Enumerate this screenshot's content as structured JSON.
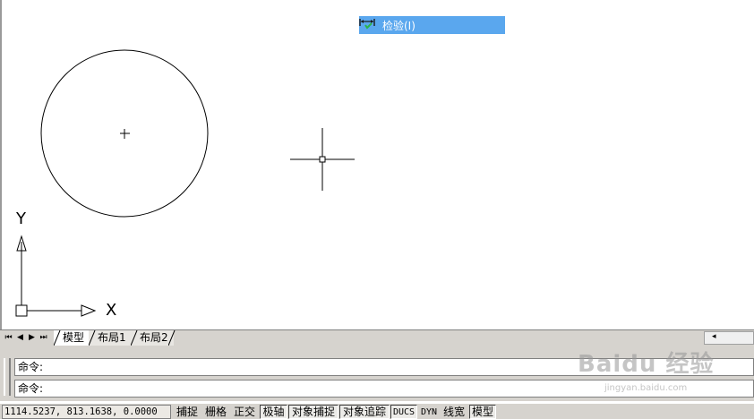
{
  "menu": {
    "item_label": "检验(I)"
  },
  "ucs": {
    "y_label": "Y",
    "x_label": "X"
  },
  "tabs": {
    "nav_first": "⏮",
    "nav_prev": "◀",
    "nav_next": "▶",
    "nav_last": "⏭",
    "items": [
      {
        "label": "模型",
        "active": true
      },
      {
        "label": "布局1",
        "active": false
      },
      {
        "label": "布局2",
        "active": false
      }
    ],
    "scroll_left": "◂"
  },
  "command": {
    "line1": "命令:",
    "line2": "命令:"
  },
  "status": {
    "coordinates": "1114.5237, 813.1638, 0.0000",
    "buttons": [
      {
        "label": "捕捉",
        "on": false
      },
      {
        "label": "栅格",
        "on": false
      },
      {
        "label": "正交",
        "on": false
      },
      {
        "label": "极轴",
        "on": true
      },
      {
        "label": "对象捕捉",
        "on": true
      },
      {
        "label": "对象追踪",
        "on": true
      },
      {
        "label": "DUCS",
        "on": true
      },
      {
        "label": "DYN",
        "on": false
      },
      {
        "label": "线宽",
        "on": false
      },
      {
        "label": "模型",
        "on": true
      }
    ]
  },
  "watermark": {
    "main": "Baidu 经验",
    "sub": "jingyan.baidu.com"
  },
  "colors": {
    "menu_highlight": "#5aa7ee",
    "chrome": "#d6d3ce"
  }
}
